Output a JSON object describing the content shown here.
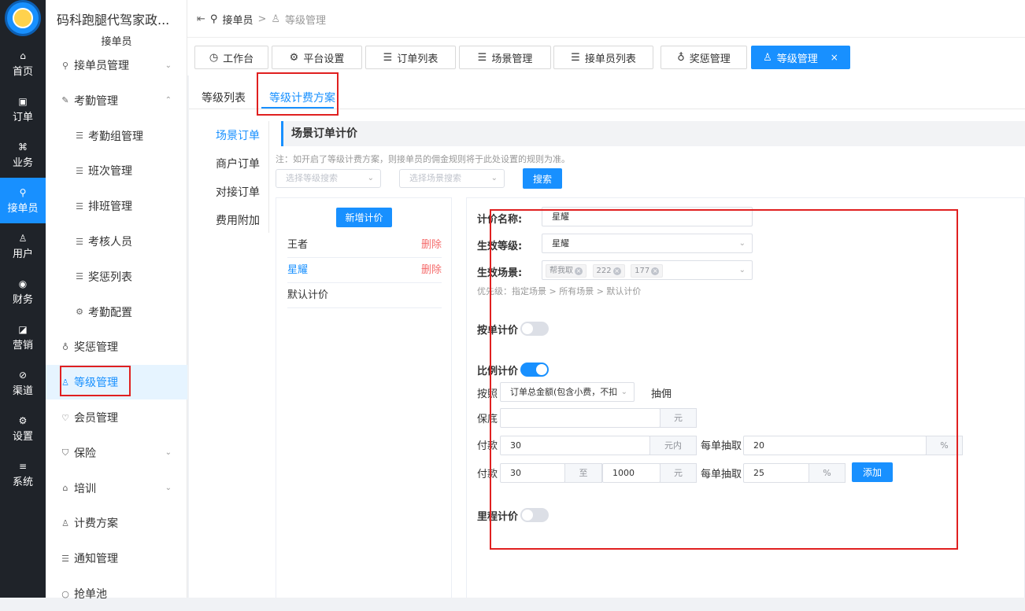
{
  "rail": [
    {
      "icon": "home-icon",
      "glyph": "⌂",
      "label": "首页"
    },
    {
      "icon": "order-icon",
      "glyph": "▣",
      "label": "订单"
    },
    {
      "icon": "business-icon",
      "glyph": "⌘",
      "label": "业务"
    },
    {
      "icon": "courier-icon",
      "glyph": "⚲",
      "label": "接单员"
    },
    {
      "icon": "user-icon",
      "glyph": "♙",
      "label": "用户"
    },
    {
      "icon": "finance-icon",
      "glyph": "◉",
      "label": "财务"
    },
    {
      "icon": "marketing-icon",
      "glyph": "◪",
      "label": "营销"
    },
    {
      "icon": "channel-icon",
      "glyph": "⊘",
      "label": "渠道"
    },
    {
      "icon": "settings-icon",
      "glyph": "⚙",
      "label": "设置"
    },
    {
      "icon": "system-icon",
      "glyph": "≡",
      "label": "系统"
    }
  ],
  "sidebar": {
    "title": "码科跑腿代驾家政...",
    "subtitle": "接单员",
    "items": [
      {
        "label": "接单员管理",
        "glyph": "⚲",
        "chev": "⌄"
      },
      {
        "label": "考勤管理",
        "glyph": "✎",
        "chev": "⌃"
      },
      {
        "label": "考勤组管理",
        "glyph": "☰",
        "chev": ""
      },
      {
        "label": "班次管理",
        "glyph": "☰",
        "chev": ""
      },
      {
        "label": "排班管理",
        "glyph": "☰",
        "chev": ""
      },
      {
        "label": "考核人员",
        "glyph": "☰",
        "chev": ""
      },
      {
        "label": "奖惩列表",
        "glyph": "☰",
        "chev": ""
      },
      {
        "label": "考勤配置",
        "glyph": "⚙",
        "chev": ""
      },
      {
        "label": "奖惩管理",
        "glyph": "♁",
        "chev": ""
      },
      {
        "label": "等级管理",
        "glyph": "♙",
        "chev": ""
      },
      {
        "label": "会员管理",
        "glyph": "♡",
        "chev": ""
      },
      {
        "label": "保险",
        "glyph": "⛉",
        "chev": "⌄"
      },
      {
        "label": "培训",
        "glyph": "⌂",
        "chev": "⌄"
      },
      {
        "label": "计费方案",
        "glyph": "♙",
        "chev": ""
      },
      {
        "label": "通知管理",
        "glyph": "☰",
        "chev": ""
      },
      {
        "label": "抢单池",
        "glyph": "○",
        "chev": ""
      }
    ]
  },
  "breadcrumb": {
    "home": "接单员",
    "sep": ">",
    "current": "等级管理"
  },
  "tags": [
    {
      "label": "工作台",
      "glyph": "◷"
    },
    {
      "label": "平台设置",
      "glyph": "⚙"
    },
    {
      "label": "订单列表",
      "glyph": "☰"
    },
    {
      "label": "场景管理",
      "glyph": "☰"
    },
    {
      "label": "接单员列表",
      "glyph": "☰"
    },
    {
      "label": "奖惩管理",
      "glyph": "♁"
    },
    {
      "label": "等级管理",
      "glyph": "♙",
      "close": "×"
    }
  ],
  "tabs": [
    "等级列表",
    "等级计费方案"
  ],
  "vtabs": [
    "场景订单",
    "商户订单",
    "对接订单",
    "费用附加"
  ],
  "section_title": "场景订单计价",
  "note": "注：如开启了等级计费方案，则接单员的佣金规则将于此处设置的规则为准。",
  "filters": {
    "level_placeholder": "选择等级搜索",
    "scene_placeholder": "选择场景搜索",
    "search": "搜索"
  },
  "list": {
    "add": "新增计价",
    "items": [
      {
        "name": "王者",
        "del": "删除"
      },
      {
        "name": "星耀",
        "del": "删除"
      },
      {
        "name": "默认计价",
        "del": ""
      }
    ]
  },
  "form": {
    "name_label": "计价名称:",
    "name_value": "星耀",
    "level_label": "生效等级:",
    "level_value": "星耀",
    "scene_label": "生效场景:",
    "scene_tags": [
      "帮我取",
      "222",
      "177"
    ],
    "priority": "优先级：指定场景 > 所有场景 > 默认计价",
    "per_order_label": "按单计价",
    "per_order_on": false,
    "ratio_label": "比例计价",
    "ratio_on": true,
    "by_label": "按照",
    "by_value": "订单总金额(包含小费，不扣",
    "commission": "抽佣",
    "min_label": "保底",
    "min_value": "",
    "yuan": "元",
    "pay_label": "付款",
    "row1_value": "30",
    "row1_unit": "元内",
    "cut_label": "每单抽取",
    "row1_cut": "20",
    "percent": "%",
    "row2_from": "30",
    "to": "至",
    "row2_to": "1000",
    "row2_cut": "25",
    "add_btn": "添加",
    "mileage_label": "里程计价",
    "mileage_on": false
  }
}
